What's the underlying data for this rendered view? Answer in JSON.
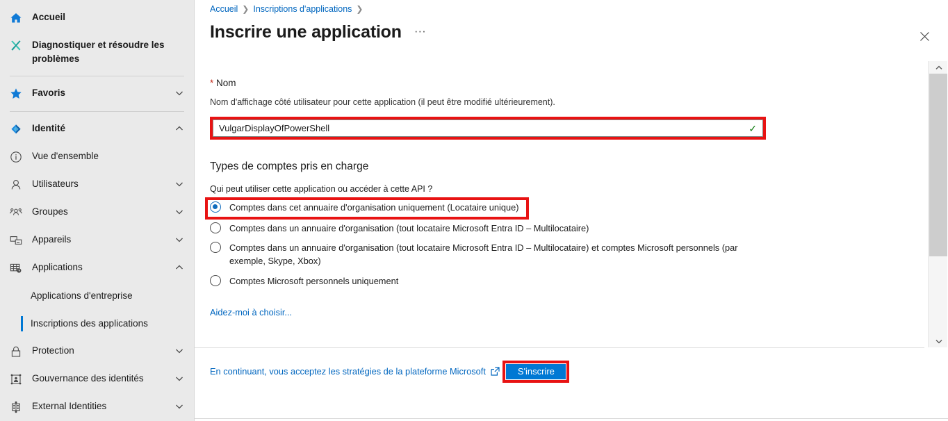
{
  "sidebar": {
    "items": [
      {
        "label": "Accueil",
        "icon": "home-icon",
        "type": "item",
        "bold": true,
        "chevron": false
      },
      {
        "label": "Diagnostiquer et résoudre les problèmes",
        "icon": "tools-icon",
        "type": "item",
        "bold": true,
        "chevron": false
      },
      {
        "type": "divider"
      },
      {
        "label": "Favoris",
        "icon": "star-icon",
        "type": "item",
        "bold": true,
        "chevron": "down"
      },
      {
        "type": "divider"
      },
      {
        "label": "Identité",
        "icon": "entra-diamond-icon",
        "type": "item",
        "bold": true,
        "chevron": "up"
      },
      {
        "label": "Vue d'ensemble",
        "icon": "info-circle-icon",
        "type": "item",
        "bold": false,
        "chevron": false
      },
      {
        "label": "Utilisateurs",
        "icon": "user-icon",
        "type": "item",
        "bold": false,
        "chevron": "down"
      },
      {
        "label": "Groupes",
        "icon": "groups-icon",
        "type": "item",
        "bold": false,
        "chevron": "down"
      },
      {
        "label": "Appareils",
        "icon": "devices-icon",
        "type": "item",
        "bold": false,
        "chevron": "down"
      },
      {
        "label": "Applications",
        "icon": "applications-grid-icon",
        "type": "item",
        "bold": false,
        "chevron": "up"
      },
      {
        "label": "Applications d'entreprise",
        "type": "sub",
        "selected": false
      },
      {
        "label": "Inscriptions des applications",
        "type": "sub",
        "selected": true
      },
      {
        "label": "Protection",
        "icon": "lock-icon",
        "type": "item",
        "bold": false,
        "chevron": "down"
      },
      {
        "label": "Gouvernance des identités",
        "icon": "identity-governance-icon",
        "type": "item",
        "bold": false,
        "chevron": "down"
      },
      {
        "label": "External Identities",
        "icon": "external-identities-icon",
        "type": "item",
        "bold": false,
        "chevron": "down"
      }
    ]
  },
  "header": {
    "breadcrumb": [
      {
        "label": "Accueil",
        "link": true
      },
      {
        "label": "Inscriptions d'applications",
        "link": true
      }
    ],
    "breadcrumb_separator": "❯",
    "title": "Inscrire une application",
    "more_actions": "···",
    "close_icon": "close-icon"
  },
  "form": {
    "name_label": "Nom",
    "required_marker": "*",
    "name_helper": "Nom d'affichage côté utilisateur pour cette application (il peut être modifié ultérieurement).",
    "name_value": "VulgarDisplayOfPowerShell",
    "name_placeholder": "",
    "name_valid_icon": "✓",
    "account_types_title": "Types de comptes pris en charge",
    "account_types_question": "Qui peut utiliser cette application ou accéder à cette API ?",
    "account_types": [
      {
        "label": "Comptes dans cet annuaire d'organisation uniquement (Locataire unique)",
        "checked": true
      },
      {
        "label": "Comptes dans un annuaire d'organisation (tout locataire Microsoft Entra ID – Multilocataire)",
        "checked": false
      },
      {
        "label": "Comptes dans un annuaire d'organisation (tout locataire Microsoft Entra ID – Multilocataire) et comptes Microsoft personnels (par exemple, Skype, Xbox)",
        "checked": false
      },
      {
        "label": "Comptes Microsoft personnels uniquement",
        "checked": false
      }
    ],
    "help_choose_link": "Aidez-moi à choisir..."
  },
  "footer": {
    "policy_text": "En continuant, vous acceptez les stratégies de la plateforme Microsoft",
    "policy_external_icon": "external-link-icon",
    "submit_label": "S'inscrire"
  },
  "scrollbar": {
    "up_arrow": "˄",
    "down_arrow": "˅"
  },
  "colors": {
    "accent": "#0078d4",
    "link": "#0066bf",
    "highlight_red": "#e81313",
    "valid_green": "#107c10",
    "sidebar_bg": "#eaeaea",
    "required_star": "#c42b1c"
  }
}
